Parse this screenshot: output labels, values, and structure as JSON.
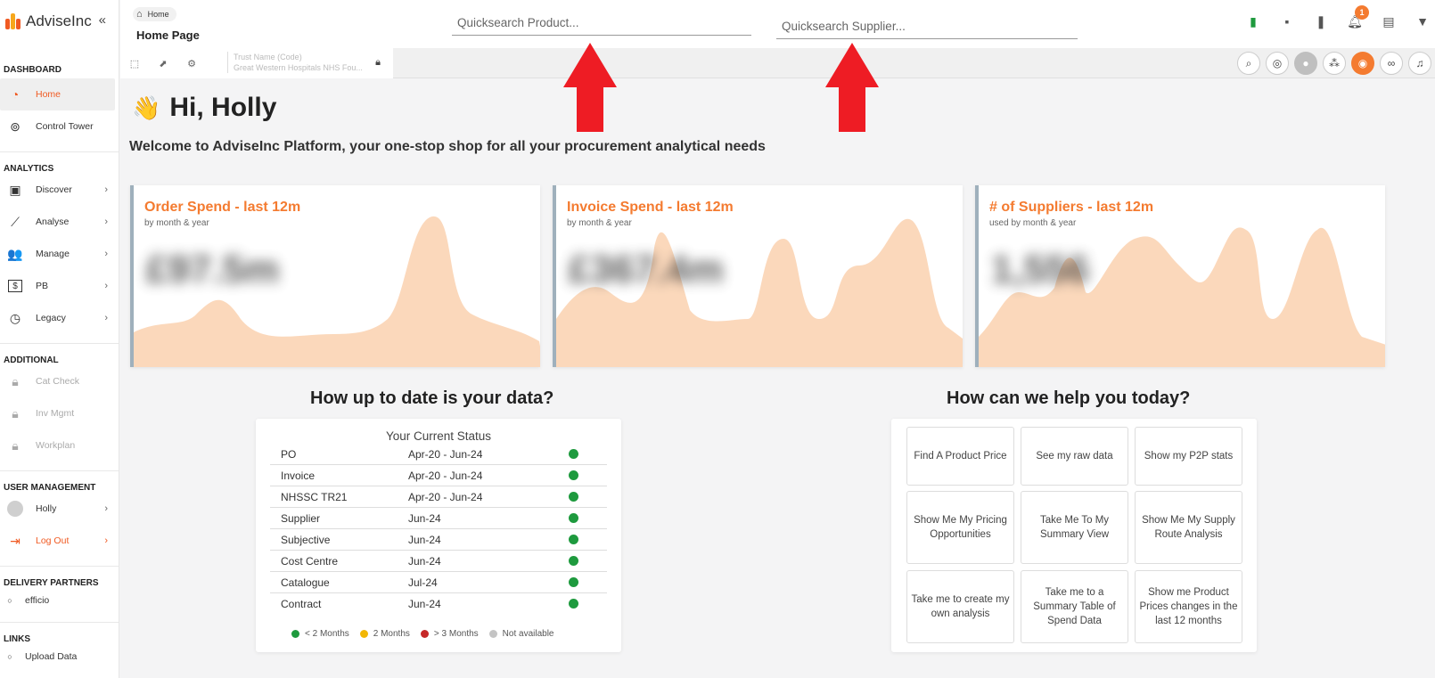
{
  "app": {
    "logo_text": "AdviseInc",
    "collapse_label": "«"
  },
  "sidebar": {
    "sections": {
      "dashboard": "DASHBOARD",
      "analytics": "ANALYTICS",
      "additional": "ADDITIONAL",
      "user_management": "USER MANAGEMENT",
      "delivery_partners": "DELIVERY PARTNERS",
      "links": "LINKS"
    },
    "items": {
      "home": "Home",
      "control_tower": "Control Tower",
      "discover": "Discover",
      "analyse": "Analyse",
      "manage": "Manage",
      "pb": "PB",
      "legacy": "Legacy",
      "cat_check": "Cat Check",
      "inv_mgmt": "Inv Mgmt",
      "workplan": "Workplan",
      "holly": "Holly",
      "log_out": "Log Out",
      "efficio": "efficio",
      "upload_data": "Upload Data"
    }
  },
  "header": {
    "breadcrumb": "Home",
    "page_title": "Home Page",
    "search_product_placeholder": "Quicksearch Product...",
    "search_supplier_placeholder": "Quicksearch Supplier...",
    "notification_count": "1",
    "trust_label": "Trust Name (Code)",
    "trust_value": "Great Western Hospitals NHS Fou..."
  },
  "greeting": {
    "emoji": "👋",
    "text": "Hi, Holly",
    "welcome": "Welcome to AdviseInc Platform, your one-stop shop for all your procurement analytical needs"
  },
  "cards": [
    {
      "title": "Order Spend - last 12m",
      "subtitle": "by month & year",
      "value": "£97.5m"
    },
    {
      "title": "Invoice Spend - last 12m",
      "subtitle": "by month & year",
      "value": "£367.4m"
    },
    {
      "title": "# of Suppliers - last 12m",
      "subtitle": "used by month & year",
      "value": "1,556"
    }
  ],
  "data_status": {
    "heading": "How up to date is your data?",
    "title": "Your Current Status",
    "rows": [
      {
        "label": "PO",
        "range": "Apr-20 - Jun-24"
      },
      {
        "label": "Invoice",
        "range": "Apr-20 - Jun-24"
      },
      {
        "label": "NHSSC TR21",
        "range": "Apr-20 - Jun-24"
      },
      {
        "label": "Supplier",
        "range": "Jun-24"
      },
      {
        "label": "Subjective",
        "range": "Jun-24"
      },
      {
        "label": "Cost Centre",
        "range": "Jun-24"
      },
      {
        "label": "Catalogue",
        "range": "Jul-24"
      },
      {
        "label": "Contract",
        "range": "Jun-24"
      }
    ],
    "legend": [
      "< 2 Months",
      "2 Months",
      "> 3 Months",
      "Not available"
    ]
  },
  "help": {
    "heading": "How can we help you today?",
    "buttons": [
      "Find A Product Price",
      "See my raw data",
      "Show my P2P stats",
      "Show Me My Pricing Opportunities",
      "Take Me To My Summary View",
      "Show Me My Supply Route Analysis",
      "Take me to create my own analysis",
      "Take me to a Summary Table of Spend Data",
      "Show me Product Prices changes in the last 12 months"
    ]
  },
  "colors": {
    "accent": "#f47b30",
    "status_green": "#1e9a3e",
    "status_amber": "#f2b705",
    "status_red": "#c62828",
    "status_na": "#c4c4c4",
    "arrow_red": "#ee1c24"
  }
}
